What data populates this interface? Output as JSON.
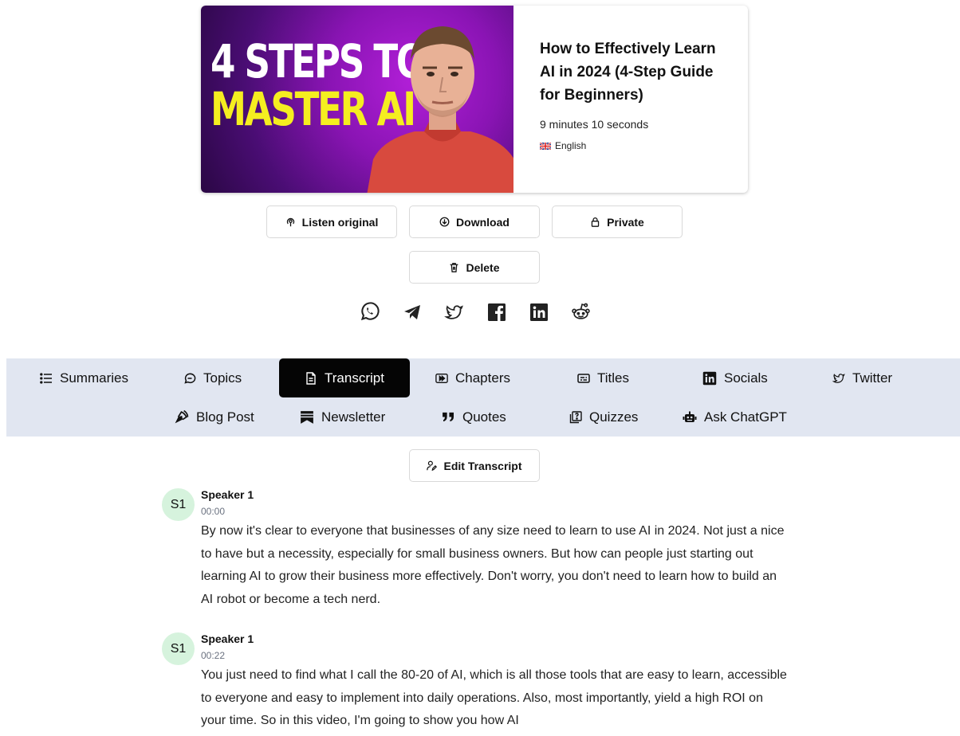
{
  "video": {
    "thumbnail_line1": "4 STEPS TO",
    "thumbnail_line2": "MASTER AI",
    "title": "How to Effectively Learn AI in 2024 (4-Step Guide for Beginners)",
    "duration": "9 minutes 10 seconds",
    "language": "English"
  },
  "actions": {
    "listen": "Listen original",
    "download": "Download",
    "private": "Private",
    "delete": "Delete"
  },
  "share_icons": [
    "whatsapp-icon",
    "telegram-icon",
    "twitter-icon",
    "facebook-icon",
    "linkedin-icon",
    "reddit-icon"
  ],
  "tabs": [
    {
      "label": "Summaries",
      "icon": "list-icon"
    },
    {
      "label": "Topics",
      "icon": "chat-bubble-icon"
    },
    {
      "label": "Transcript",
      "icon": "document-icon",
      "active": true
    },
    {
      "label": "Chapters",
      "icon": "play-forward-icon"
    },
    {
      "label": "Titles",
      "icon": "caption-icon"
    },
    {
      "label": "Socials",
      "icon": "linkedin-icon"
    },
    {
      "label": "Twitter",
      "icon": "twitter-icon"
    },
    {
      "label": "Blog Post",
      "icon": "pen-nib-icon"
    },
    {
      "label": "Newsletter",
      "icon": "newspaper-icon"
    },
    {
      "label": "Quotes",
      "icon": "quote-icon"
    },
    {
      "label": "Quizzes",
      "icon": "quiz-icon"
    },
    {
      "label": "Ask ChatGPT",
      "icon": "robot-icon"
    }
  ],
  "edit_transcript": "Edit Transcript",
  "transcript": [
    {
      "avatar": "S1",
      "speaker": "Speaker 1",
      "time": "00:00",
      "text": "By now it's clear to everyone that businesses of any size need to learn to use AI in 2024. Not just a nice to have but a necessity, especially for small business owners. But how can people just starting out learning AI to grow their business more effectively. Don't worry, you don't need to learn how to build an AI robot or become a tech nerd."
    },
    {
      "avatar": "S1",
      "speaker": "Speaker 1",
      "time": "00:22",
      "text": "You just need to find what I call the 80-20 of AI, which is all those tools that are easy to learn, accessible to everyone and easy to implement into daily operations. Also, most importantly, yield a high ROI on your time. So in this video, I'm going to show you how AI"
    }
  ],
  "colors": {
    "tab_bar_bg": "#e1e6f1",
    "active_tab_bg": "#050505",
    "avatar_bg": "#d6f3dd",
    "thumb_yellow": "#f5ee20",
    "thumb_purple": "#8a14b4"
  }
}
